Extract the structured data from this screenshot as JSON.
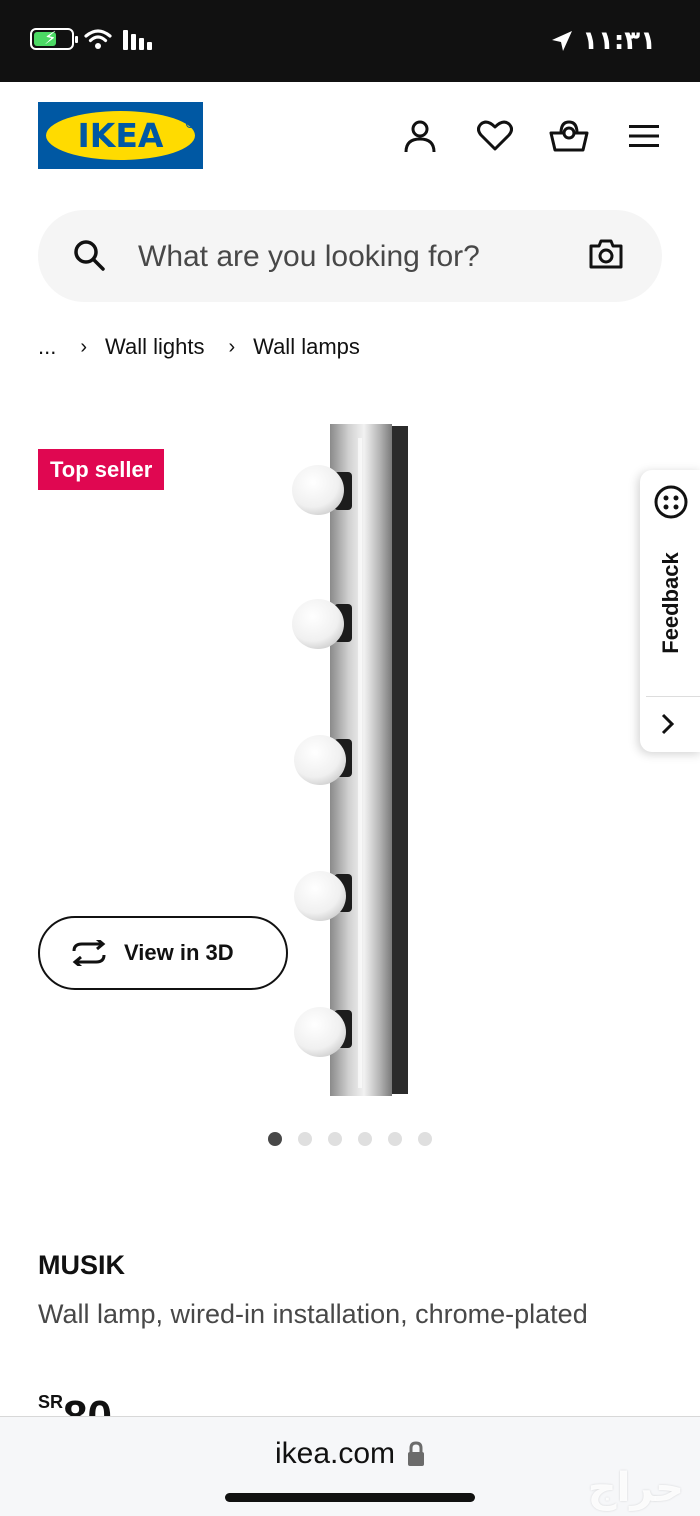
{
  "status_bar": {
    "time": "١١:٣١",
    "icons": [
      "battery-charging-icon",
      "wifi-icon",
      "signal-icon",
      "location-arrow-icon"
    ]
  },
  "header": {
    "logo_text": "IKEA",
    "icons": [
      "account-icon",
      "heart-icon",
      "basket-icon",
      "menu-icon"
    ]
  },
  "search": {
    "placeholder": "What are you looking for?"
  },
  "breadcrumb": {
    "items": [
      "...",
      "Wall lights",
      "Wall lamps"
    ]
  },
  "product_media": {
    "badge": "Top seller",
    "view_3d_label": "View in 3D",
    "image_count": 6,
    "active_image_index": 0
  },
  "feedback": {
    "label": "Feedback"
  },
  "product": {
    "name": "MUSIK",
    "description": "Wall lamp, wired-in installation, chrome-plated",
    "currency": "SR",
    "price": "80"
  },
  "browser": {
    "url": "ikea.com",
    "watermark": "حراج"
  },
  "colors": {
    "ikea_blue": "#0058a3",
    "ikea_yellow": "#ffdb00",
    "badge_red": "#e00751"
  }
}
